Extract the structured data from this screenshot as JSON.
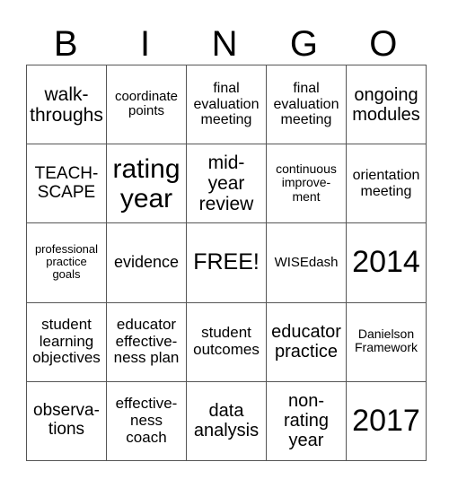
{
  "header": {
    "letters": [
      "B",
      "I",
      "N",
      "G",
      "O"
    ]
  },
  "board": {
    "rows": [
      [
        {
          "text": "walk-\nthroughs"
        },
        {
          "text": "coordinate\npoints"
        },
        {
          "text": "final\nevaluation\nmeeting"
        },
        {
          "text": "final\nevaluation\nmeeting"
        },
        {
          "text": "ongoing\nmodules"
        }
      ],
      [
        {
          "text": "TEACH-\nSCAPE"
        },
        {
          "text": "rating\nyear"
        },
        {
          "text": "mid-\nyear\nreview"
        },
        {
          "text": "continuous\nimprove-\nment"
        },
        {
          "text": "orientation\nmeeting"
        }
      ],
      [
        {
          "text": "professional\npractice\ngoals"
        },
        {
          "text": "evidence"
        },
        {
          "text": "FREE!"
        },
        {
          "text": "WISEdash"
        },
        {
          "text": "2014"
        }
      ],
      [
        {
          "text": "student\nlearning\nobjectives"
        },
        {
          "text": "educator\neffective-\nness plan"
        },
        {
          "text": "student\noutcomes"
        },
        {
          "text": "educator\npractice"
        },
        {
          "text": "Danielson\nFramework"
        }
      ],
      [
        {
          "text": "observa-\ntions"
        },
        {
          "text": "effective-\nness\ncoach"
        },
        {
          "text": "data\nanalysis"
        },
        {
          "text": "non-\nrating\nyear"
        },
        {
          "text": "2017"
        }
      ]
    ]
  }
}
